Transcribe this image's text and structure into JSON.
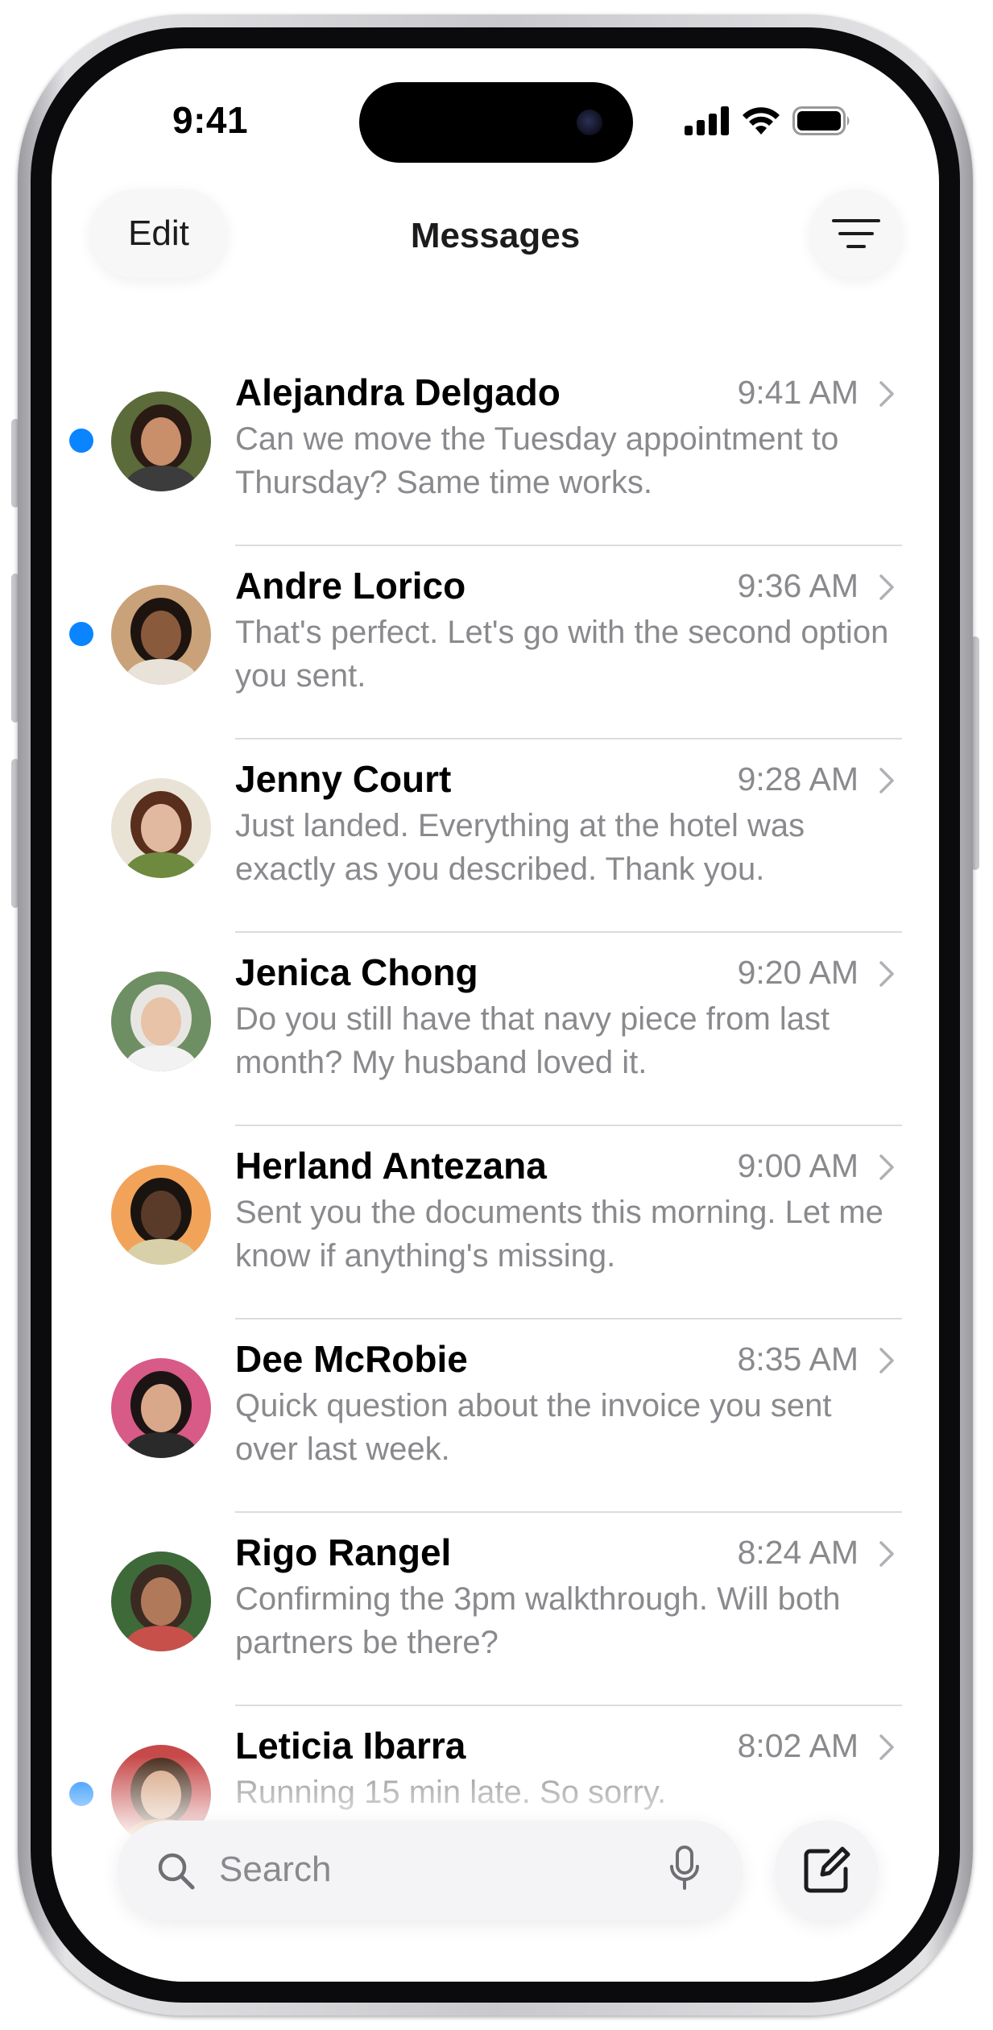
{
  "status_bar": {
    "time": "9:41",
    "icons": [
      "cellular-signal-icon",
      "wifi-icon",
      "battery-icon"
    ]
  },
  "nav": {
    "edit_label": "Edit",
    "title": "Messages",
    "filter_icon": "filter-lines-icon"
  },
  "accent_color": "#0a84ff",
  "conversations": [
    {
      "name": "Alejandra Delgado",
      "time": "9:41 AM",
      "preview": "Can we move the Tuesday appointment to Thursday? Same time works.",
      "unread": true
    },
    {
      "name": "Andre Lorico",
      "time": "9:36 AM",
      "preview": "That's perfect. Let's go with the second option you sent.",
      "unread": true
    },
    {
      "name": "Jenny Court",
      "time": "9:28 AM",
      "preview": "Just landed. Everything at the hotel was exactly as you described. Thank you.",
      "unread": false
    },
    {
      "name": "Jenica Chong",
      "time": "9:20 AM",
      "preview": "Do you still have that navy piece from last month? My husband loved it.",
      "unread": false
    },
    {
      "name": "Herland Antezana",
      "time": "9:00 AM",
      "preview": "Sent you the documents this morning. Let me know if anything's missing.",
      "unread": false
    },
    {
      "name": "Dee McRobie",
      "time": "8:35 AM",
      "preview": "Quick question about the invoice you sent over last week.",
      "unread": false
    },
    {
      "name": "Rigo Rangel",
      "time": "8:24 AM",
      "preview": "Confirming the 3pm walkthrough. Will both partners be there?",
      "unread": false
    },
    {
      "name": "Leticia Ibarra",
      "time": "8:02 AM",
      "preview": "Running 15 min late. So sorry.",
      "unread": true
    }
  ],
  "bottom_bar": {
    "search_placeholder": "Search",
    "mic_icon": "microphone-icon",
    "compose_icon": "compose-icon"
  }
}
